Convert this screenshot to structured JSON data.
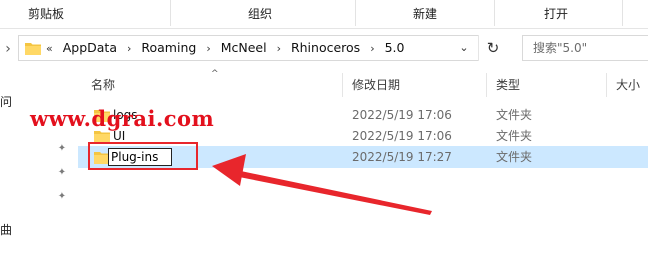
{
  "ribbon": {
    "groups": [
      "剪贴板",
      "组织",
      "新建",
      "打开"
    ]
  },
  "address": {
    "crumbs": [
      "AppData",
      "Roaming",
      "McNeel",
      "Rhinoceros",
      "5.0"
    ],
    "overflow": "«",
    "dropdown_icon": "chevron-down-icon",
    "refresh_icon": "refresh-icon"
  },
  "search": {
    "placeholder": "搜索\"5.0\""
  },
  "left_nav": {
    "partial_labels": [
      "问",
      "曲"
    ]
  },
  "columns": {
    "name": "名称",
    "date": "修改日期",
    "type": "类型",
    "size": "大小"
  },
  "files": [
    {
      "name": "logs",
      "date": "2022/5/19 17:06",
      "type": "文件夹"
    },
    {
      "name": "UI",
      "date": "2022/5/19 17:06",
      "type": "文件夹"
    },
    {
      "name": "Plug-ins",
      "date": "2022/5/19 17:27",
      "type": "文件夹",
      "selected": true,
      "renaming": true
    }
  ],
  "watermark": "www.dgrai.com",
  "colors": {
    "selection": "#cce8ff",
    "folder": "#f4c542",
    "annotation": "#e8262c"
  }
}
